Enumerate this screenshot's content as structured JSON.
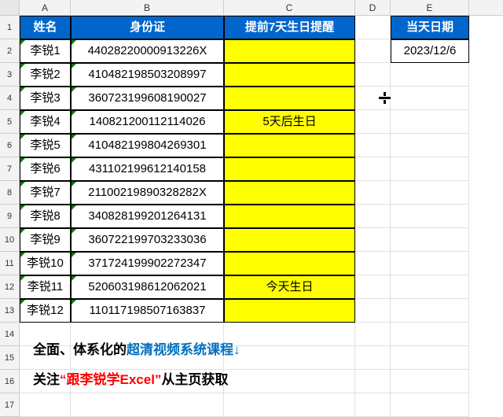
{
  "columns": [
    "A",
    "B",
    "C",
    "D",
    "E"
  ],
  "rowCount": 17,
  "headers": {
    "name": "姓名",
    "id": "身份证",
    "reminder": "提前7天生日提醒",
    "today": "当天日期"
  },
  "todayDate": "2023/12/6",
  "rows": [
    {
      "name": "李锐1",
      "id": "44028220000913226X",
      "reminder": ""
    },
    {
      "name": "李锐2",
      "id": "410482198503208997",
      "reminder": ""
    },
    {
      "name": "李锐3",
      "id": "360723199608190027",
      "reminder": ""
    },
    {
      "name": "李锐4",
      "id": "140821200112114026",
      "reminder": "5天后生日"
    },
    {
      "name": "李锐5",
      "id": "410482199804269301",
      "reminder": ""
    },
    {
      "name": "李锐6",
      "id": "431102199612140158",
      "reminder": ""
    },
    {
      "name": "李锐7",
      "id": "21100219890328282X",
      "reminder": ""
    },
    {
      "name": "李锐8",
      "id": "340828199201264131",
      "reminder": ""
    },
    {
      "name": "李锐9",
      "id": "360722199703233036",
      "reminder": ""
    },
    {
      "name": "李锐10",
      "id": "371724199902272347",
      "reminder": ""
    },
    {
      "name": "李锐11",
      "id": "520603198612062021",
      "reminder": "今天生日"
    },
    {
      "name": "李锐12",
      "id": "110117198507163837",
      "reminder": ""
    }
  ],
  "footer": {
    "line1_a": "全面、体系化的",
    "line1_b": "超清视频系统课程↓",
    "line2_a": "关注",
    "line2_b": "“跟李锐学Excel”",
    "line2_c": "从主页获取"
  }
}
